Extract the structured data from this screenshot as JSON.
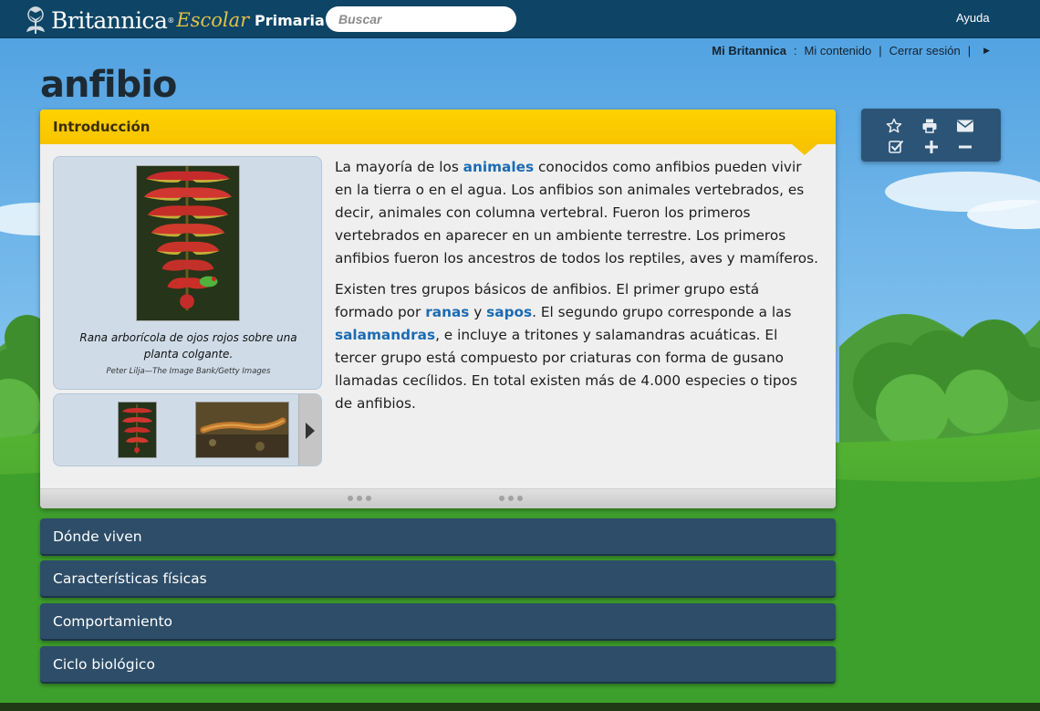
{
  "header": {
    "brand": "Britannica",
    "brand_sub": "Escolar",
    "level": "Primaria",
    "search_placeholder": "Buscar",
    "help": "Ayuda"
  },
  "userlinks": {
    "my_britannica": "Mi Britannica",
    "colon": ":",
    "my_content": "Mi contenido",
    "logout": "Cerrar sesión"
  },
  "article": {
    "title": "anfibio",
    "section_title": "Introducción",
    "image_caption": "Rana arborícola de ojos rojos sobre una planta colgante.",
    "image_credit": "Peter Lilja—The Image Bank/Getty Images",
    "para1": {
      "t1": "La mayoría de los ",
      "link1": "animales",
      "t2": " conocidos como anfibios pueden vivir en la tierra o en el agua. Los anfibios son animales vertebrados, es decir, animales con columna vertebral. Fueron los primeros vertebrados en aparecer en un ambiente terrestre. Los primeros anfibios fueron los ancestros de todos los reptiles, aves y mamíferos."
    },
    "para2": {
      "t1": "Existen tres grupos básicos de anfibios. El primer grupo está formado por ",
      "link1": "ranas",
      "t2": " y ",
      "link2": "sapos",
      "t3": ". El segundo grupo corresponde a las ",
      "link3": "salamandras",
      "t4": ", e incluye a tritones y salamandras acuáticas. El tercer grupo está compuesto por criaturas con forma de gusano llamadas cecílidos. En total existen más de 4.000 especies o tipos de anfibios."
    }
  },
  "sections": [
    {
      "label": "Dónde viven"
    },
    {
      "label": "Características físicas"
    },
    {
      "label": "Comportamiento"
    },
    {
      "label": "Ciclo biológico"
    }
  ],
  "tools": [
    "star-icon",
    "print-icon",
    "email-icon",
    "checklist-icon",
    "zoom-in-icon",
    "zoom-out-icon"
  ],
  "colors": {
    "topbar": "#0e4566",
    "accent_yellow": "#ffd100",
    "link": "#1c6bb3",
    "section_bar": "#2d4d68"
  }
}
